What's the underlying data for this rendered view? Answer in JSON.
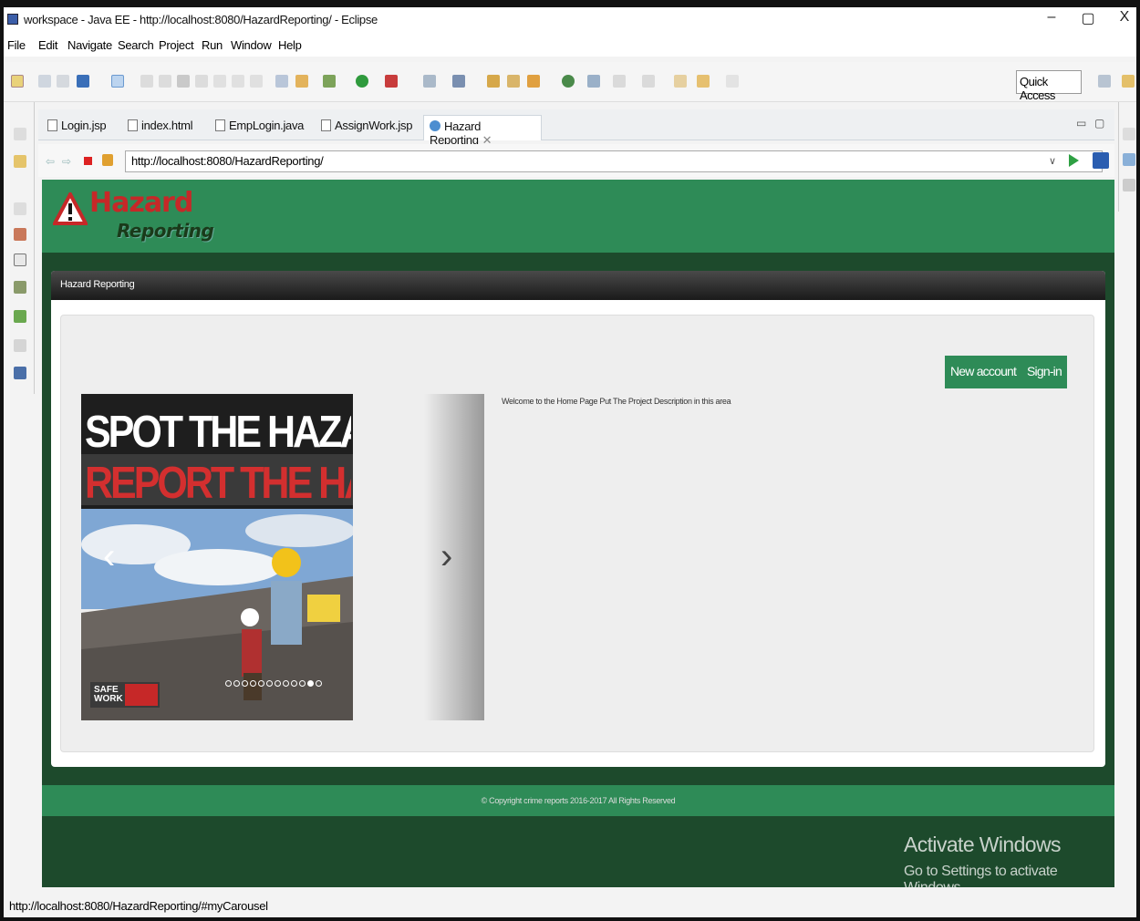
{
  "window": {
    "title": "workspace - Java EE - http://localhost:8080/HazardReporting/ - Eclipse",
    "minimize": "–",
    "maximize": "▢",
    "close": "X"
  },
  "menu": [
    "File",
    "Edit",
    "Navigate",
    "Search",
    "Project",
    "Run",
    "Window",
    "Help"
  ],
  "toolbar": {
    "quick_access": "Quick Access"
  },
  "tabs": [
    {
      "label": "Login.jsp",
      "active": false
    },
    {
      "label": "index.html",
      "active": false
    },
    {
      "label": "EmpLogin.java",
      "active": false
    },
    {
      "label": "AssignWork.jsp",
      "active": false
    },
    {
      "label": "Hazard Reporting",
      "active": true
    }
  ],
  "browser": {
    "url": "http://localhost:8080/HazardReporting/"
  },
  "page": {
    "logo_title": "Hazard",
    "logo_subtitle": "Reporting",
    "panel_heading": "Hazard Reporting",
    "welcome_text": "Welcome to the Home Page Put The Project Description in this area",
    "new_account": "New account",
    "sign_in": "Sign-in",
    "carousel": {
      "line1": "SPOT THE HAZARD",
      "line2": "REPORT THE HAZARD",
      "badge": "SAFE WORK",
      "prev": "‹",
      "next": "›",
      "dot_count": 12,
      "active_dot": 10
    },
    "copyright": "© Copyright crime reports 2016-2017 All Rights Reserved"
  },
  "watermark": {
    "line1": "Activate Windows",
    "line2": "Go to Settings to activate Windows."
  },
  "statusbar": {
    "text": "http://localhost:8080/HazardReporting/#myCarousel"
  }
}
